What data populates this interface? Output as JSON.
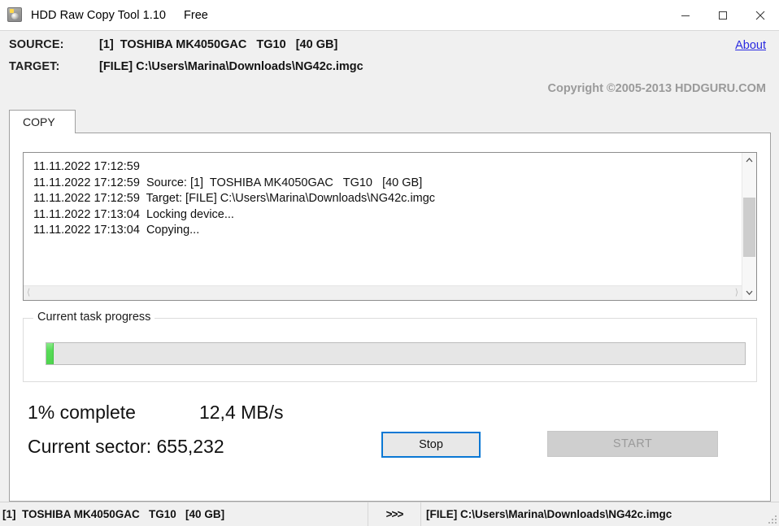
{
  "window": {
    "title": "HDD Raw Copy Tool 1.10",
    "edition": "Free",
    "icon": "hdd-icon",
    "controls": {
      "minimize": "minimize-icon",
      "maximize": "maximize-icon",
      "close": "close-icon"
    }
  },
  "header": {
    "source_label": "SOURCE:",
    "source_value": "[1]  TOSHIBA MK4050GAC   TG10   [40 GB]",
    "target_label": "TARGET:",
    "target_value": "[FILE] C:\\Users\\Marina\\Downloads\\NG42c.imgc",
    "about_link": "About",
    "copyright": "Copyright ©2005-2013 HDDGURU.COM"
  },
  "tabs": [
    {
      "label": "COPY",
      "active": true
    }
  ],
  "log": {
    "lines": [
      "11.11.2022 17:12:59",
      "11.11.2022 17:12:59  Source: [1]  TOSHIBA MK4050GAC   TG10   [40 GB]",
      "11.11.2022 17:12:59  Target: [FILE] C:\\Users\\Marina\\Downloads\\NG42c.imgc",
      "11.11.2022 17:13:04  Locking device...",
      "11.11.2022 17:13:04  Copying..."
    ],
    "scroll_up_icon": "chevron-up-icon",
    "scroll_down_icon": "chevron-down-icon",
    "scroll_left_icon": "chevron-left-icon",
    "scroll_right_icon": "chevron-right-icon"
  },
  "progress": {
    "group_label": "Current task progress",
    "percent": 1,
    "fill_color": "#4ed44e",
    "track_color": "#e6e6e6"
  },
  "status": {
    "percent_text": "1% complete",
    "speed_text": "12,4 MB/s",
    "sector_text": "Current sector: 655,232"
  },
  "buttons": {
    "stop": "Stop",
    "start": "START",
    "start_disabled": true,
    "focus_color": "#0a78d4"
  },
  "statusbar": {
    "source": "[1]  TOSHIBA MK4050GAC   TG10   [40 GB]",
    "arrow": ">>>",
    "target": "[FILE] C:\\Users\\Marina\\Downloads\\NG42c.imgc",
    "grip_icon": "resize-grip-icon"
  }
}
